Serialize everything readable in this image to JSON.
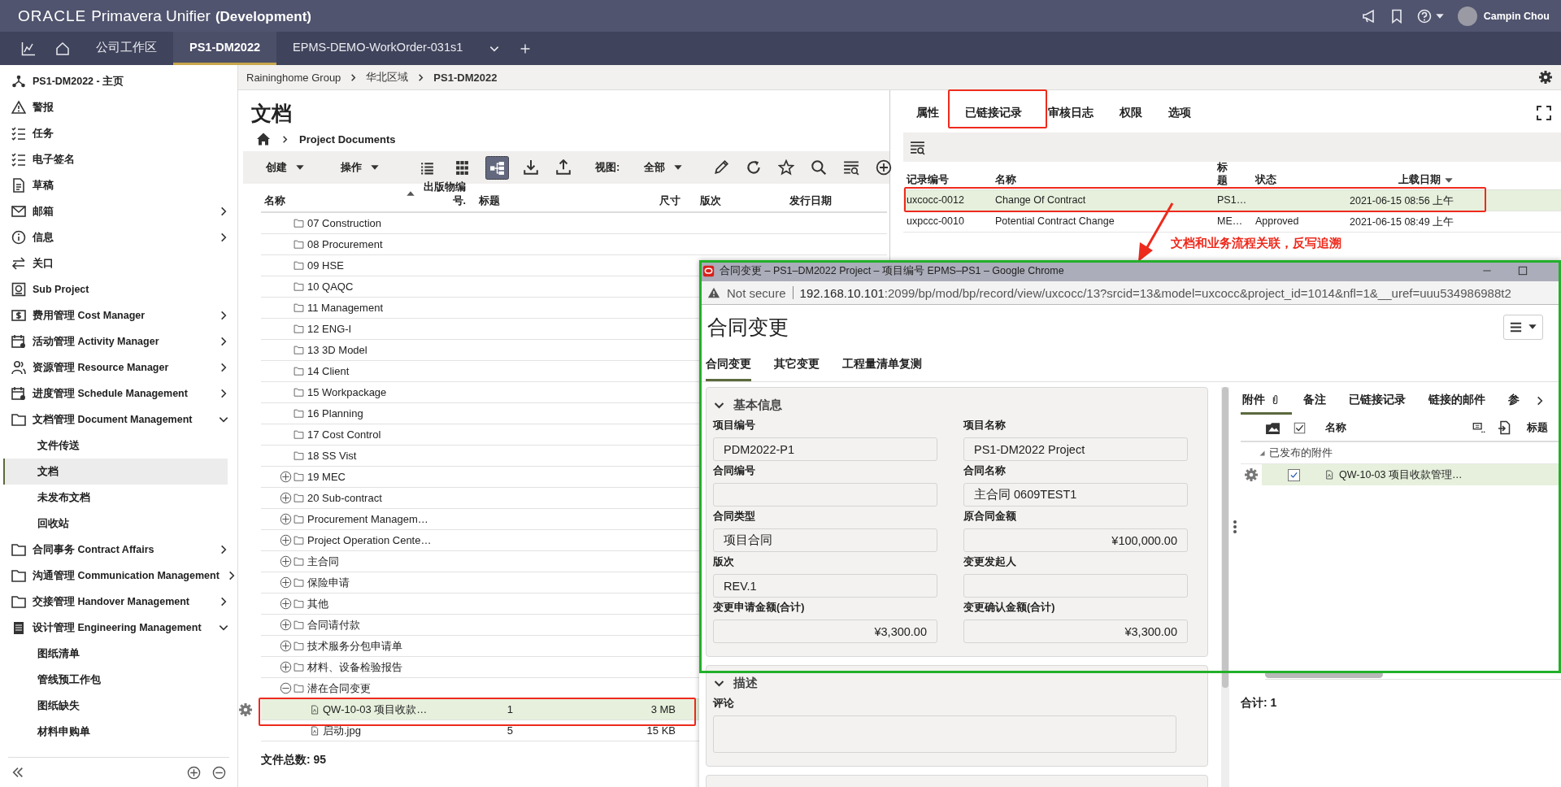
{
  "header": {
    "brand": "ORACLE",
    "product": "Primavera Unifier",
    "environment": "(Development)",
    "user": "Campin Chou"
  },
  "tabs": [
    {
      "label": "公司工作区",
      "selected": false
    },
    {
      "label": "PS1-DM2022",
      "selected": true
    },
    {
      "label": "EPMS-DEMO-WorkOrder-031s1",
      "selected": false
    }
  ],
  "sidebar": {
    "items": [
      {
        "label": "PS1-DM2022 - 主页",
        "kind": "link",
        "selected": false
      },
      {
        "label": "警报",
        "kind": "link",
        "selected": false
      },
      {
        "label": "任务",
        "kind": "link",
        "selected": false
      },
      {
        "label": "电子签名",
        "kind": "link",
        "selected": false
      },
      {
        "label": "草稿",
        "kind": "link",
        "selected": false
      },
      {
        "label": "邮箱",
        "kind": "group",
        "expanded": false,
        "selected": false
      },
      {
        "label": "信息",
        "kind": "group",
        "expanded": false,
        "selected": false
      },
      {
        "label": "关口",
        "kind": "link",
        "selected": false
      },
      {
        "label": "Sub Project",
        "kind": "link",
        "selected": false
      },
      {
        "label": "费用管理 Cost Manager",
        "kind": "group",
        "expanded": false,
        "selected": false
      },
      {
        "label": "活动管理 Activity Manager",
        "kind": "group",
        "expanded": false,
        "selected": false
      },
      {
        "label": "资源管理 Resource Manager",
        "kind": "group",
        "expanded": false,
        "selected": false
      },
      {
        "label": "进度管理 Schedule Management",
        "kind": "group",
        "expanded": false,
        "selected": false
      },
      {
        "label": "文档管理 Document Management",
        "kind": "group",
        "expanded": true,
        "selected": false,
        "children": [
          {
            "label": "文件传送",
            "selected": false
          },
          {
            "label": "文档",
            "selected": true
          },
          {
            "label": "未发布文档",
            "selected": false
          },
          {
            "label": "回收站",
            "selected": false
          }
        ]
      },
      {
        "label": "合同事务 Contract Affairs",
        "kind": "group",
        "expanded": false,
        "selected": false
      },
      {
        "label": "沟通管理 Communication Management",
        "kind": "group",
        "expanded": false,
        "selected": false
      },
      {
        "label": "交接管理 Handover Management",
        "kind": "group",
        "expanded": false,
        "selected": false
      },
      {
        "label": "设计管理 Engineering Management",
        "kind": "group",
        "expanded": true,
        "selected": false,
        "children": [
          {
            "label": "图纸清单",
            "selected": false
          },
          {
            "label": "管线预工作包",
            "selected": false
          },
          {
            "label": "图纸缺失",
            "selected": false
          },
          {
            "label": "材料申购单",
            "selected": false
          }
        ]
      }
    ]
  },
  "breadcrumb": [
    "Raininghome Group",
    "华北区域",
    "PS1-DM2022"
  ],
  "documents": {
    "title": "文档",
    "path": "Project Documents",
    "toolbar": {
      "create": "创建",
      "actions": "操作",
      "view_label": "视图:",
      "view_value": "全部",
      "view_modes": [
        {
          "selected": false
        },
        {
          "selected": false
        },
        {
          "selected": true
        }
      ]
    },
    "columns": [
      {
        "label": "名称",
        "sort_descending": false
      },
      {
        "label": "出版物编号."
      },
      {
        "label": "标题"
      },
      {
        "label": "尺寸"
      },
      {
        "label": "版次"
      },
      {
        "label": "发行日期"
      }
    ],
    "rows": [
      {
        "name": "07 Construction",
        "kind": "folder",
        "selected": false
      },
      {
        "name": "08 Procurement",
        "kind": "folder",
        "selected": false
      },
      {
        "name": "09 HSE",
        "kind": "folder",
        "selected": false
      },
      {
        "name": "10 QAQC",
        "kind": "folder",
        "selected": false
      },
      {
        "name": "11 Management",
        "kind": "folder",
        "selected": false
      },
      {
        "name": "12 ENG-I",
        "kind": "folder",
        "selected": false
      },
      {
        "name": "13 3D Model",
        "kind": "folder",
        "selected": false
      },
      {
        "name": "14 Client",
        "kind": "folder",
        "selected": false
      },
      {
        "name": "15 Workpackage",
        "kind": "folder",
        "selected": false
      },
      {
        "name": "16 Planning",
        "kind": "folder",
        "selected": false
      },
      {
        "name": "17 Cost Control",
        "kind": "folder",
        "selected": false
      },
      {
        "name": "18 SS Vist",
        "kind": "folder",
        "selected": false
      },
      {
        "name": "19 MEC",
        "kind": "group",
        "expanded": false,
        "selected": false
      },
      {
        "name": "20 Sub-contract",
        "kind": "group",
        "expanded": false,
        "selected": false
      },
      {
        "name": "Procurement Managem…",
        "kind": "group",
        "expanded": false,
        "selected": false
      },
      {
        "name": "Project Operation Cente…",
        "kind": "group",
        "expanded": false,
        "selected": false
      },
      {
        "name": "主合同",
        "kind": "group",
        "expanded": false,
        "selected": false
      },
      {
        "name": "保险申请",
        "kind": "group",
        "expanded": false,
        "selected": false
      },
      {
        "name": "其他",
        "kind": "group",
        "expanded": false,
        "selected": false
      },
      {
        "name": "合同请付款",
        "kind": "group",
        "expanded": false,
        "selected": false
      },
      {
        "name": "技术服务分包申请单",
        "kind": "group",
        "expanded": false,
        "selected": false
      },
      {
        "name": "材料、设备检验报告",
        "kind": "group",
        "expanded": false,
        "selected": false
      },
      {
        "name": "潜在合同变更",
        "kind": "group",
        "expanded": true,
        "selected": false,
        "children": [
          {
            "name": "QW-10-03 项目收款…",
            "kind": "file",
            "pub_no": "1",
            "size": "3 MB",
            "selected": true
          },
          {
            "name": "启动.jpg",
            "kind": "file",
            "pub_no": "5",
            "size": "15 KB",
            "selected": false
          }
        ]
      }
    ],
    "total": "文件总数: 95"
  },
  "details": {
    "tabs": [
      {
        "label": "属性"
      },
      {
        "label": "已链接记录"
      },
      {
        "label": "审核日志"
      },
      {
        "label": "权限"
      },
      {
        "label": "选项"
      }
    ],
    "columns": [
      {
        "label": "记录编号"
      },
      {
        "label": "名称"
      },
      {
        "label": "标题"
      },
      {
        "label": "状态"
      },
      {
        "label": "上载日期",
        "sort_descending": true
      }
    ],
    "rows": [
      {
        "number": "uxcocc-0012",
        "name": "Change Of Contract",
        "title": "PS1…",
        "date": "2021-06-15 08:56 上午",
        "selected": true
      },
      {
        "number": "uxpccc-0010",
        "name": "Potential Contract Change",
        "title": "ME…",
        "status": "Approved",
        "date": "2021-06-15 08:49 上午",
        "selected": false
      }
    ]
  },
  "annotation": {
    "text": "文档和业务流程关联，反写追溯"
  },
  "popup": {
    "window_title": "合同变更 – PS1–DM2022 Project – 项目编号 EPMS–PS1 – Google Chrome",
    "security": "Not secure",
    "url_host": "192.168.10.101",
    "url_rest": ":2099/bp/mod/bp/record/view/uxcocc/13?srcid=13&model=uxcocc&project_id=1014&nfl=1&__uref=uuu534986988t2",
    "title": "合同变更",
    "tabs": [
      {
        "label": "合同变更",
        "selected": true
      },
      {
        "label": "其它变更",
        "selected": false
      },
      {
        "label": "工程量清单复测",
        "selected": false
      }
    ],
    "sections": [
      {
        "title": "基本信息",
        "expanded": true,
        "fields": [
          {
            "label": "项目编号",
            "value": "PDM2022-P1"
          },
          {
            "label": "项目名称",
            "value": "PS1-DM2022 Project"
          },
          {
            "label": "合同编号"
          },
          {
            "label": "合同名称",
            "value": "主合同 0609TEST1"
          },
          {
            "label": "合同类型",
            "value": "项目合同"
          },
          {
            "label": "原合同金额",
            "value": "¥100,000.00",
            "kind": "amount"
          },
          {
            "label": "版次",
            "value": "REV.1"
          },
          {
            "label": "变更发起人"
          },
          {
            "label": "变更申请金额(合计)",
            "value": "¥3,300.00",
            "kind": "amount"
          },
          {
            "label": "变更确认金额(合计)",
            "value": "¥3,300.00",
            "kind": "amount"
          }
        ]
      },
      {
        "title": "描述",
        "expanded": true,
        "fields": [
          {
            "label": "评论",
            "kind": "textarea"
          }
        ]
      }
    ],
    "side_tabs": [
      {
        "label": "附件",
        "selected": true
      },
      {
        "label": "备注",
        "selected": false
      },
      {
        "label": "已链接记录",
        "selected": false
      },
      {
        "label": "链接的邮件",
        "selected": false
      },
      {
        "label": "参",
        "selected": false
      }
    ],
    "attachments": {
      "columns": [
        "名称",
        "标题"
      ],
      "group": {
        "label": "已发布的附件",
        "expanded": true
      },
      "rows": [
        {
          "name": "QW-10-03 项目收款管理…",
          "checked": true,
          "selected": true
        }
      ],
      "total": "合计: 1"
    }
  }
}
